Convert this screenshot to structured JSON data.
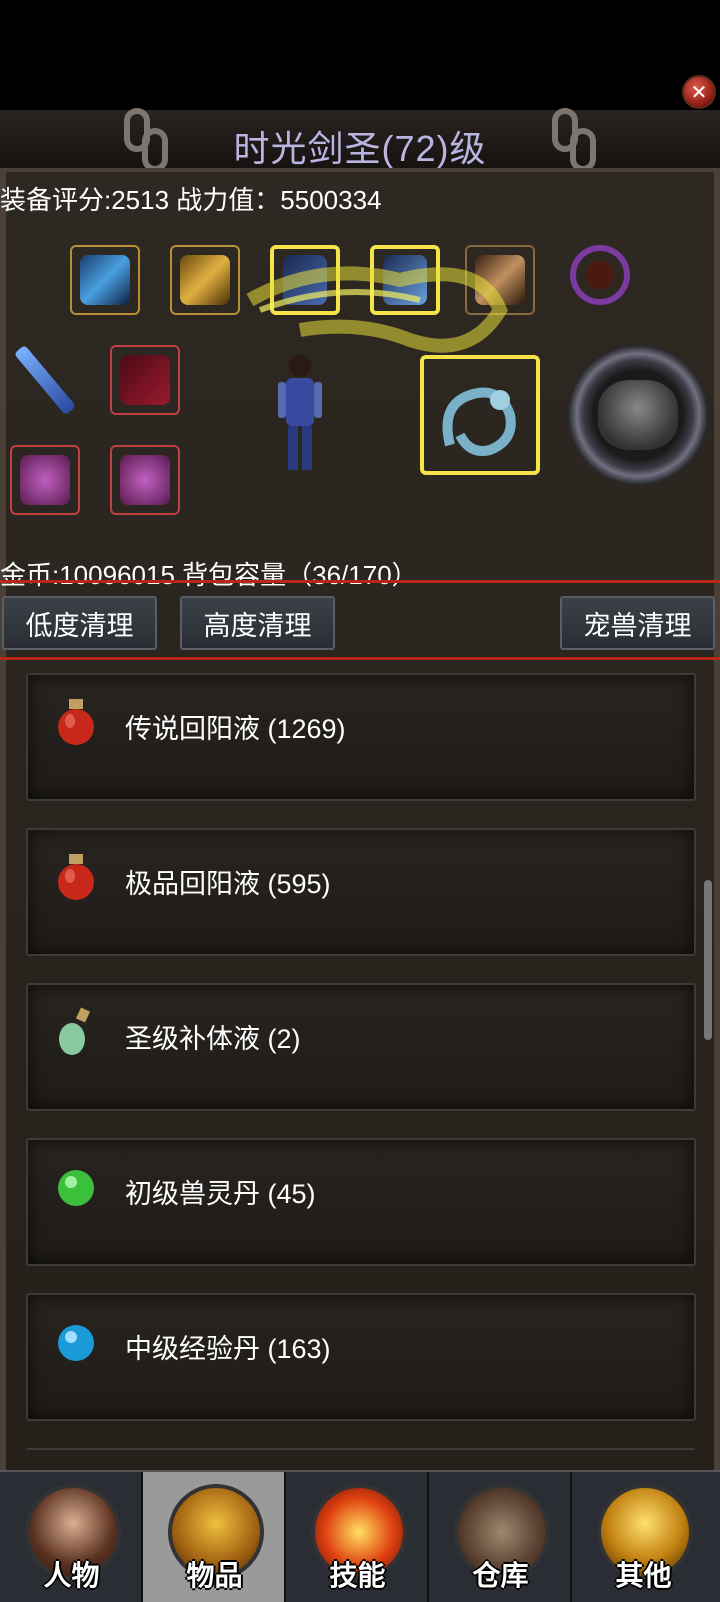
{
  "header": {
    "title": "时光剑圣(72)级"
  },
  "stats": {
    "equip_score_label": "装备评分:2513 战力值：5500334"
  },
  "inventory": {
    "gold_line": "金币:10096015 背包容量（36/170）"
  },
  "actions": {
    "low_clean": "低度清理",
    "high_clean": "高度清理",
    "pet_clean": "宠兽清理"
  },
  "items": [
    {
      "label": "传说回阳液 (1269)",
      "icon": "red-potion-icon"
    },
    {
      "label": "极品回阳液 (595)",
      "icon": "red-potion-icon"
    },
    {
      "label": "圣级补体液 (2)",
      "icon": "green-vial-icon"
    },
    {
      "label": "初级兽灵丹 (45)",
      "icon": "green-orb-icon"
    },
    {
      "label": "中级经验丹 (163)",
      "icon": "blue-orb-icon"
    }
  ],
  "tabs": [
    {
      "label": "人物",
      "icon": "character-portrait-icon"
    },
    {
      "label": "物品",
      "icon": "armor-icon"
    },
    {
      "label": "技能",
      "icon": "sword-icon"
    },
    {
      "label": "仓库",
      "icon": "chest-icon"
    },
    {
      "label": "其他",
      "icon": "trophy-icon"
    }
  ],
  "active_tab": "物品",
  "colors": {
    "title": "#b9b4e0",
    "separator": "#b8281a",
    "active_tab": "#9a9a9a"
  }
}
